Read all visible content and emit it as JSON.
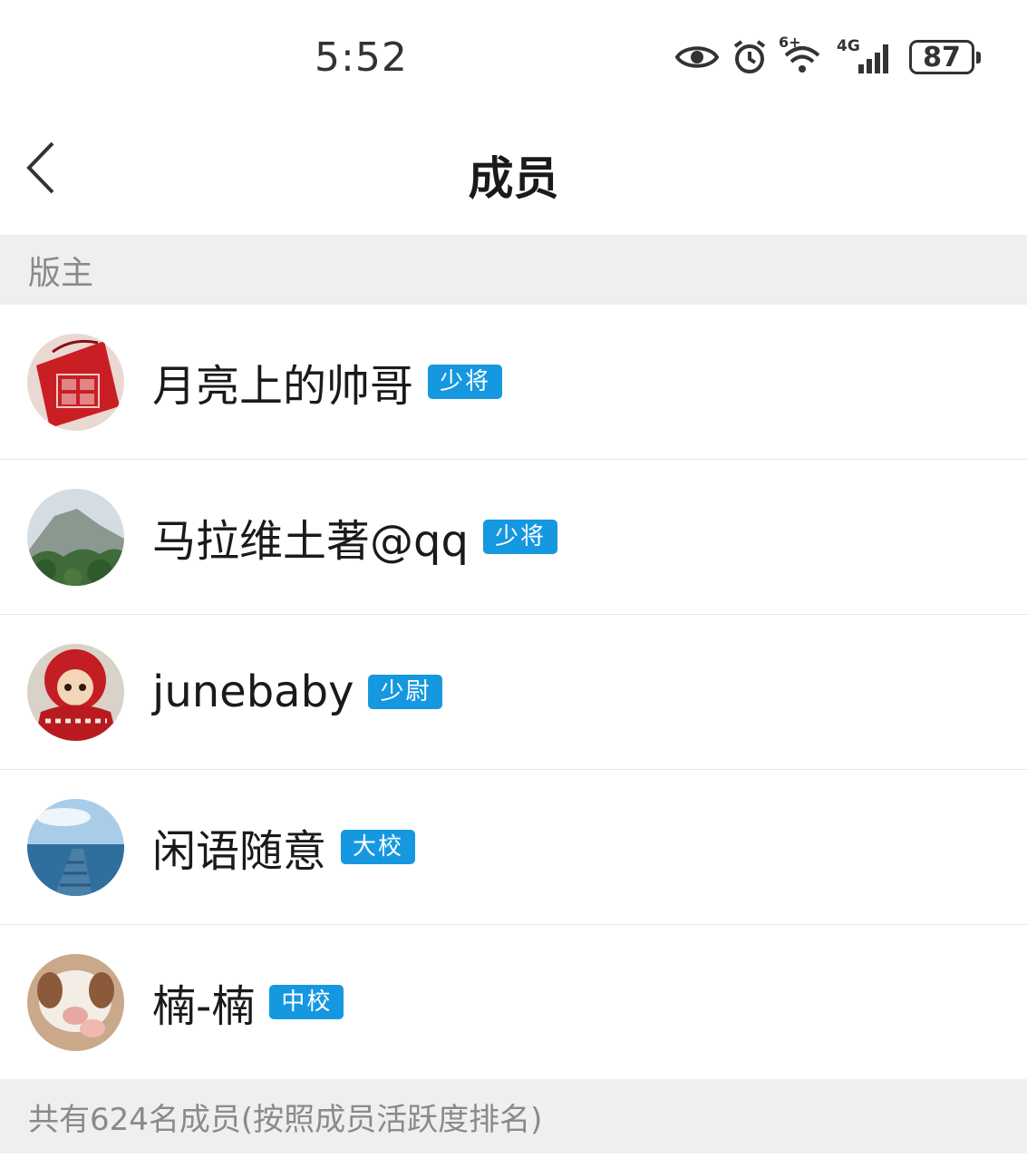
{
  "status_bar": {
    "time": "5:52",
    "icons": [
      "eye-icon",
      "alarm-icon",
      "wifi-icon",
      "signal-icon"
    ],
    "network_label": "4G",
    "wifi_label": "6+",
    "battery_level": "87"
  },
  "header": {
    "title": "成员",
    "back_icon": "chevron-left-icon"
  },
  "section": {
    "moderators_label": "版主"
  },
  "members": [
    {
      "name": "月亮上的帅哥",
      "rank": "少将",
      "avatar": "red-pouch-avatar"
    },
    {
      "name": "马拉维土著@qq",
      "rank": "少将",
      "avatar": "mountain-avatar"
    },
    {
      "name": "junebaby",
      "rank": "少尉",
      "avatar": "doll-avatar"
    },
    {
      "name": "闲语随意",
      "rank": "大校",
      "avatar": "pier-avatar"
    },
    {
      "name": "楠-楠",
      "rank": "中校",
      "avatar": "puppy-avatar"
    }
  ],
  "footer": {
    "summary": "共有624名成员(按照成员活跃度排名)"
  },
  "colors": {
    "badge": "#1598e0",
    "section_bg": "#efefef",
    "muted_text": "#8a8a8a"
  }
}
